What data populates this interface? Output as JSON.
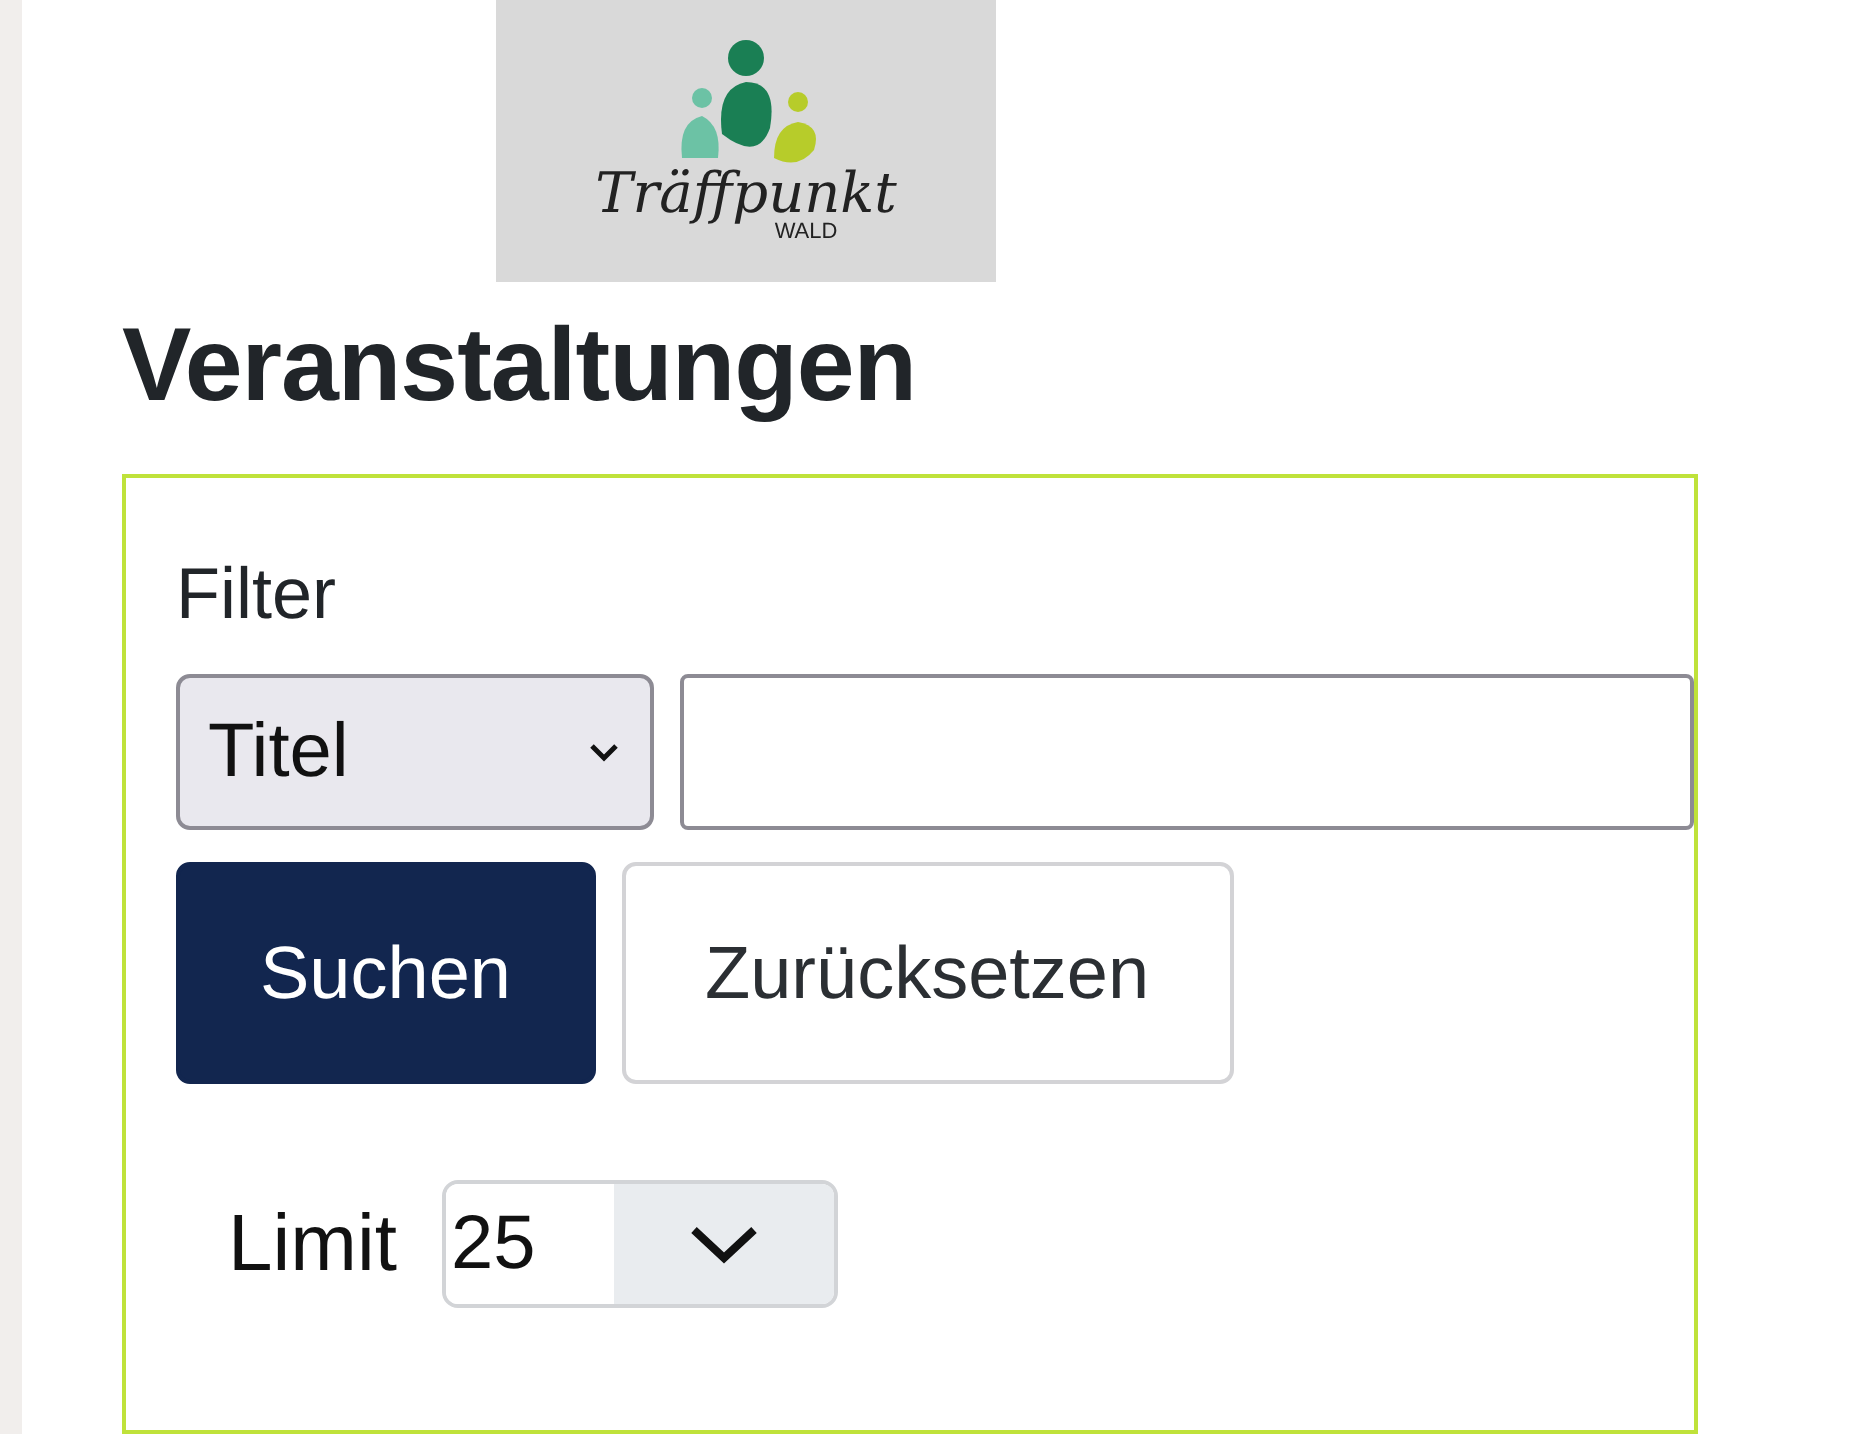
{
  "logo": {
    "script_text": "Träffpunkt",
    "sub_text": "WALD"
  },
  "heading": "Veranstaltungen",
  "filter": {
    "legend": "Filter",
    "field_select": {
      "value": "Titel"
    },
    "buttons": [
      {
        "label": "Suchen",
        "kind": "primary"
      },
      {
        "label": "Zurücksetzen",
        "kind": "secondary"
      }
    ],
    "limit": {
      "label": "Limit",
      "value": "25"
    }
  }
}
